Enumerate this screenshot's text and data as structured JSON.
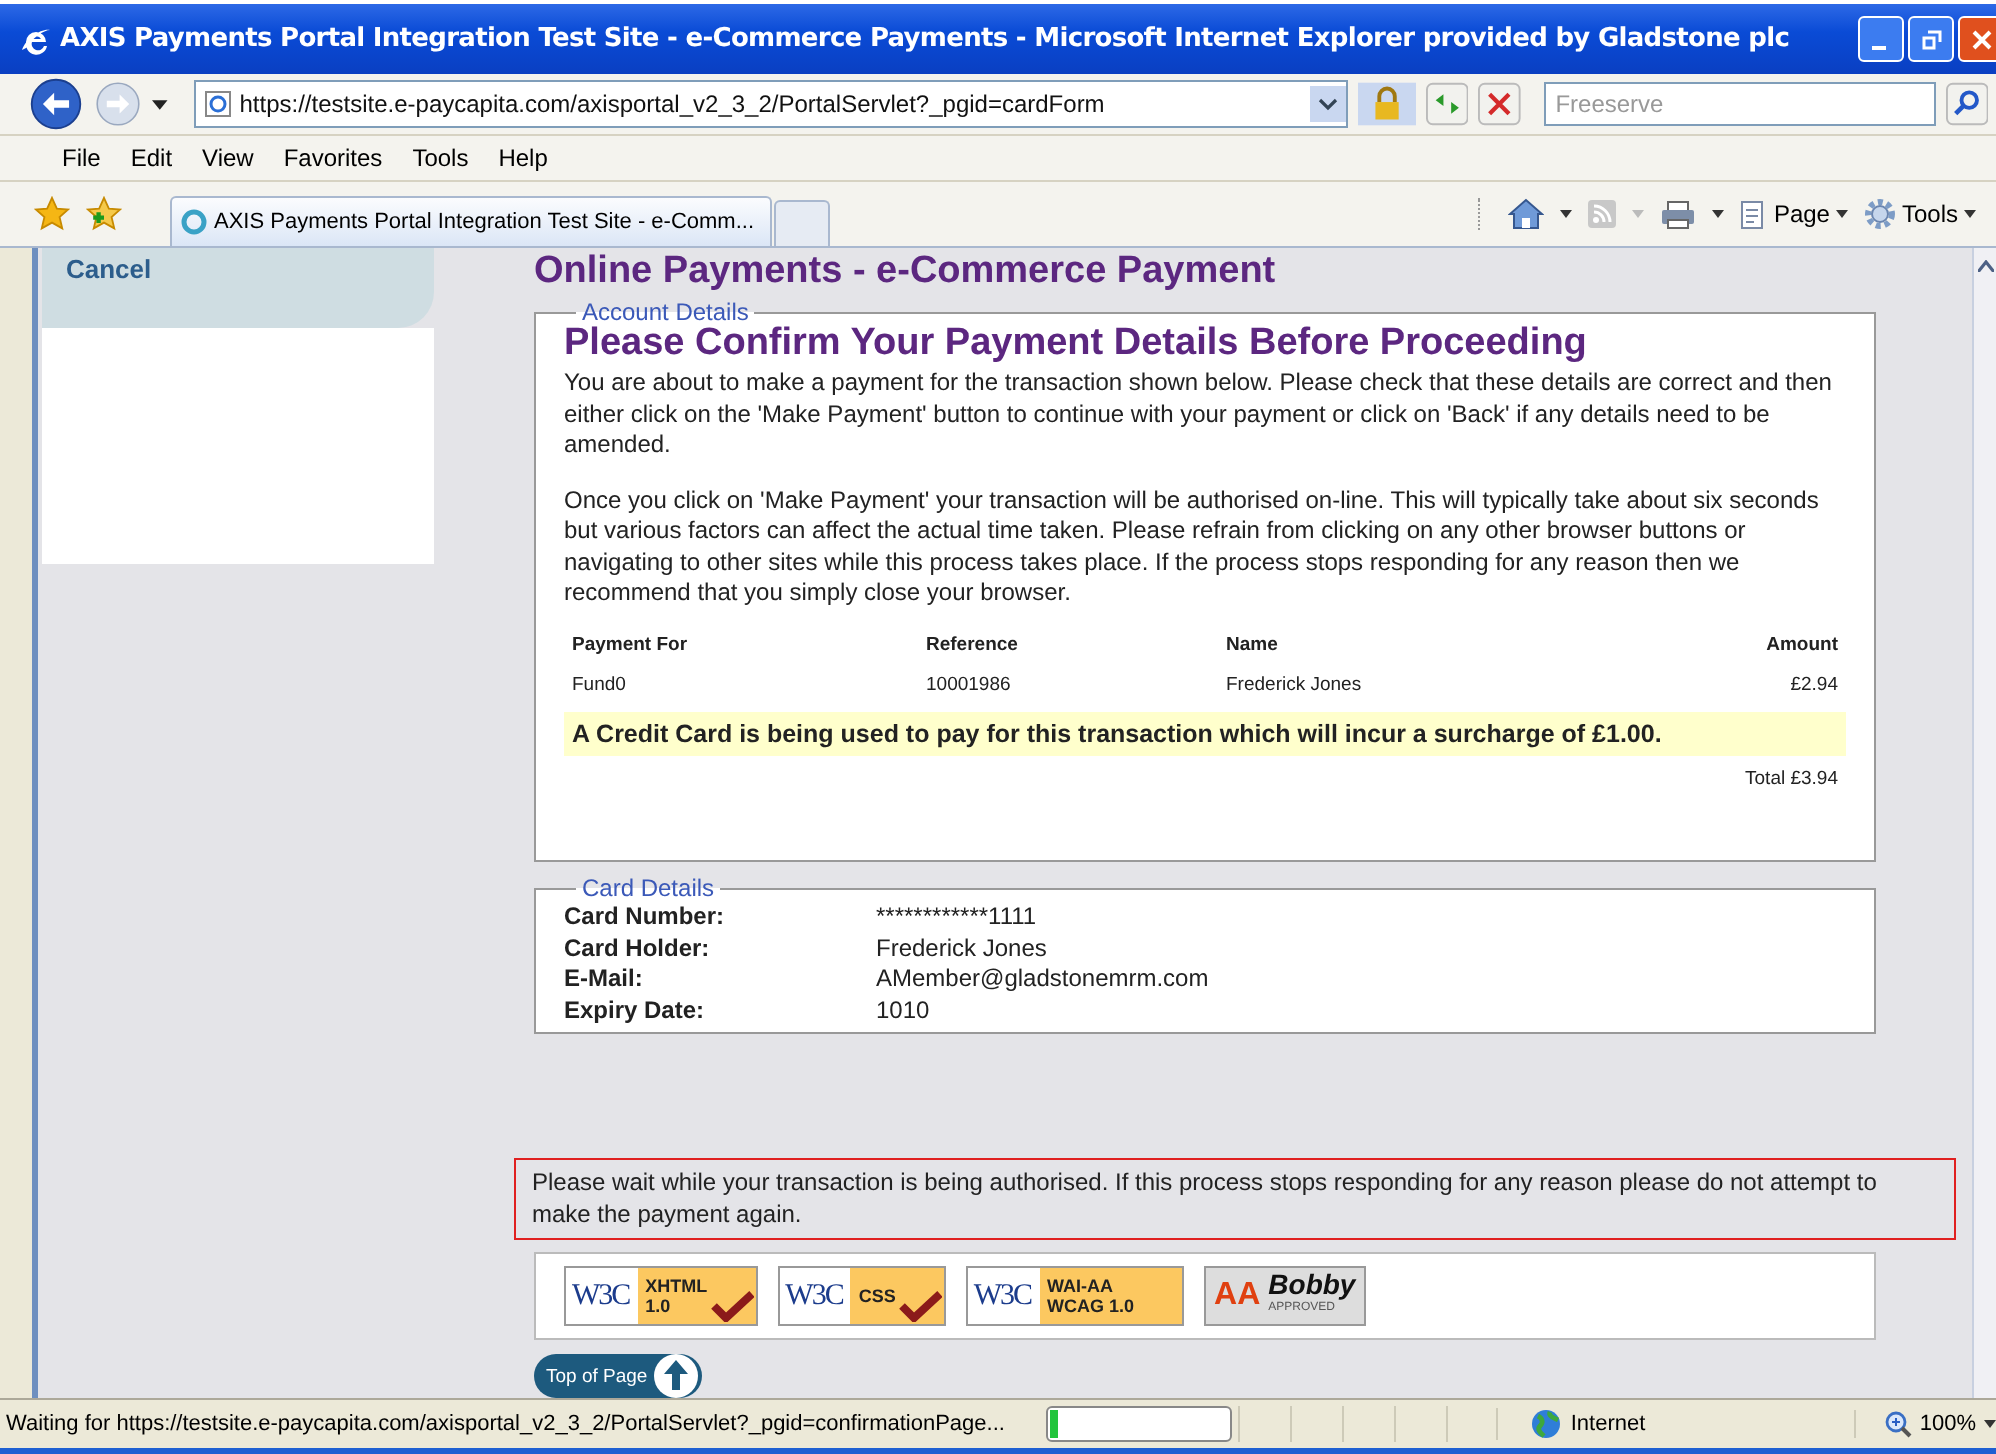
{
  "window": {
    "title": "AXIS Payments Portal Integration Test Site - e-Commerce Payments - Microsoft Internet Explorer provided by Gladstone plc"
  },
  "address_bar": {
    "url": "https://testsite.e-paycapita.com/axisportal_v2_3_2/PortalServlet?_pgid=cardForm",
    "search_placeholder": "Freeserve"
  },
  "menu": [
    "File",
    "Edit",
    "View",
    "Favorites",
    "Tools",
    "Help"
  ],
  "tabs": [
    {
      "label": "AXIS Payments Portal Integration Test Site - e-Comm...",
      "selected": true
    }
  ],
  "command_bar": [
    "Page",
    "Tools"
  ],
  "sidebar": {
    "cancel": "Cancel"
  },
  "page_title": "Online Payments - e-Commerce Payment",
  "account_details": {
    "legend": "Account Details",
    "heading": "Please Confirm Your Payment Details Before Proceeding",
    "paragraphs": [
      "You are about to make a payment for the transaction shown below. Please check that these details are correct and then either click on the 'Make Payment' button to continue with your payment or click on 'Back' if any details need to be amended.",
      "Once you click on 'Make Payment' your transaction will be authorised on-line. This will typically take about six seconds but various factors can affect the actual time taken. Please refrain from clicking on any other browser buttons or navigating to other sites while this process takes place. If the process stops responding for any reason then we recommend that you simply close your browser."
    ],
    "table": {
      "columns": [
        "Payment For",
        "Reference",
        "Name",
        "Amount"
      ],
      "rows": [
        [
          "Fund0",
          "10001986",
          "Frederick Jones",
          "£2.94"
        ]
      ]
    },
    "surcharge": "A Credit Card is being used to pay for this transaction which will incur a surcharge of £1.00.",
    "total": "Total £3.94"
  },
  "card_details": {
    "legend": "Card Details",
    "fields": [
      {
        "label": "Card Number:",
        "value": "************1111"
      },
      {
        "label": "Card Holder:",
        "value": "Frederick Jones"
      },
      {
        "label": "E-Mail:",
        "value": "AMember@gladstonemrm.com"
      },
      {
        "label": "Expiry Date:",
        "value": "1010"
      }
    ]
  },
  "notice": "Please wait while your transaction is being authorised. If this process stops responding for any reason please do not attempt to make the payment again.",
  "badges": [
    {
      "kind": "w3c",
      "logo": "W3C",
      "lines": [
        "XHTML",
        "1.0"
      ],
      "checked": true
    },
    {
      "kind": "w3c",
      "logo": "W3C",
      "lines": [
        "CSS"
      ],
      "checked": true
    },
    {
      "kind": "w3c",
      "logo": "W3C",
      "lines": [
        "WAI-AA",
        "WCAG 1.0"
      ],
      "checked": false
    },
    {
      "kind": "bobby",
      "logo": "AA",
      "lines": [
        "Bobby",
        "APPROVED"
      ]
    }
  ],
  "top_link": "Top of Page",
  "status_bar": {
    "text": "Waiting for https://testsite.e-paycapita.com/axisportal_v2_3_2/PortalServlet?_pgid=confirmationPage...",
    "progress": {
      "level": 0.04
    },
    "zone": "Internet",
    "zoom": "100%"
  }
}
